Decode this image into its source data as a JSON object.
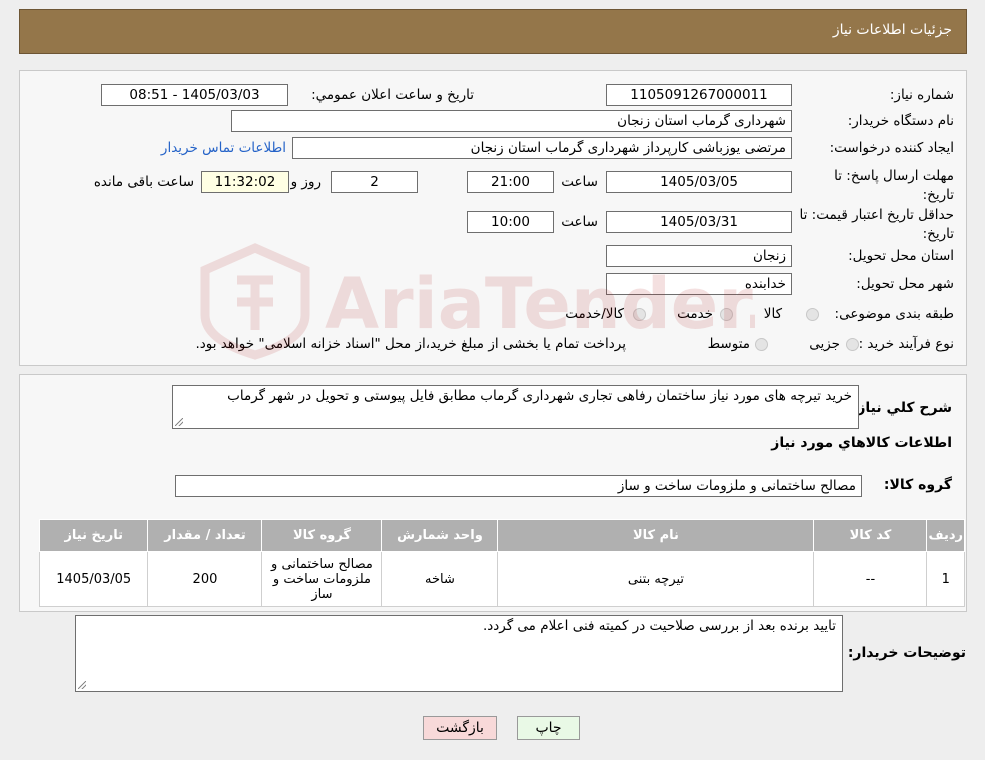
{
  "header": {
    "title": "جزئیات اطلاعات نیاز"
  },
  "form": {
    "need_number_label": "شماره نیاز:",
    "need_number": "1105091267000011",
    "announce_label": "تاریخ و ساعت اعلان عمومي:",
    "announce_value": "1405/03/03 - 08:51",
    "buyer_label": "نام دستگاه خریدار:",
    "buyer_value": "شهرداری گرماب استان زنجان",
    "creator_label": "ایجاد کننده درخواست:",
    "creator_value": "مرتضی یوزباشی کارپرداز شهرداری گرماب استان زنجان",
    "contact_link": "اطلاعات تماس خریدار",
    "deadline_label": "مهلت ارسال پاسخ: تا تاریخ:",
    "deadline_date": "1405/03/05",
    "time_label": "ساعت",
    "deadline_time": "21:00",
    "days_value": "2",
    "days_label": "روز و",
    "remaining_time": "11:32:02",
    "remaining_label": "ساعت باقی مانده",
    "validity_label": "حداقل تاریخ اعتبار قیمت: تا تاریخ:",
    "validity_date": "1405/03/31",
    "validity_time": "10:00",
    "province_label": "استان محل تحویل:",
    "province_value": "زنجان",
    "city_label": "شهر محل تحویل:",
    "city_value": "خدابنده",
    "category_label": "طبقه بندی موضوعی:",
    "category_options": [
      "کالا",
      "خدمت",
      "کالا/خدمت"
    ],
    "process_label": "نوع فرآیند خرید :",
    "process_options": [
      "جزیی",
      "متوسط"
    ],
    "process_note": "پرداخت تمام یا بخشی از مبلغ خرید،از محل \"اسناد خزانه اسلامی\" خواهد بود."
  },
  "description": {
    "label": "شرح کلي نیاز:",
    "text": "خرید تیرچه های مورد نیاز ساختمان رفاهی تجاری شهرداری گرماب مطابق فایل پیوستی و تحویل در شهر گرماب",
    "goods_info_title": "اطلاعات کالاهاي مورد نیاز",
    "group_label": "گروه کالا:",
    "group_value": "مصالح ساختمانی و ملزومات ساخت و ساز"
  },
  "table": {
    "headers": [
      "ردیف",
      "کد کالا",
      "نام کالا",
      "واحد شمارش",
      "گروه کالا",
      "تعداد / مقدار",
      "تاریخ نیاز"
    ],
    "rows": [
      [
        "1",
        "--",
        "تیرچه بتنی",
        "شاخه",
        "مصالح ساختمانی و ملزومات ساخت و ساز",
        "200",
        "1405/03/05"
      ]
    ]
  },
  "buyer_notes": {
    "label": "توضیحات خریدار:",
    "text": "تایید برنده بعد از بررسی صلاحیت در کمیته فنی اعلام می گردد."
  },
  "buttons": {
    "print": "چاپ",
    "back": "بازگشت"
  },
  "watermark": {
    "text": "AriaTender.neT"
  },
  "colors": {
    "header_bg": "#94764a",
    "link": "#2563c8",
    "back_btn": "#f8d9d9",
    "print_btn": "#e9f9e6"
  }
}
